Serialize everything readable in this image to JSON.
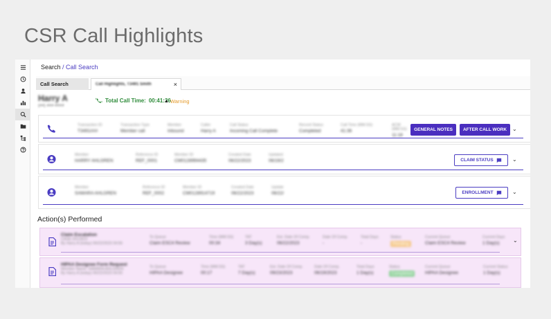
{
  "page": {
    "title": "CSR Call Highlights"
  },
  "sidebar": {
    "items": [
      {
        "icon": "menu-icon"
      },
      {
        "icon": "history-icon"
      },
      {
        "icon": "person-icon"
      },
      {
        "icon": "bar-chart-icon"
      },
      {
        "icon": "search-icon",
        "active": true
      },
      {
        "icon": "folder-icon"
      },
      {
        "icon": "hierarchy-icon"
      },
      {
        "icon": "help-icon"
      }
    ]
  },
  "breadcrumb": {
    "root": "Search",
    "separator": " / ",
    "current": "Call Search"
  },
  "tabs": [
    {
      "label": "Call Search"
    },
    {
      "label": "Call Highlights, T3491 Smith",
      "close": "×"
    }
  ],
  "member": {
    "name": "Harry A",
    "sub": "(##) ###-####"
  },
  "call": {
    "label": "Total Call Time:",
    "value": "00:41:36",
    "warning": "Warning"
  },
  "call_card": {
    "fields": [
      {
        "k": "Transaction ID",
        "v": "T3491###"
      },
      {
        "k": "Transaction Type",
        "v": "Member call"
      },
      {
        "k": "Member",
        "v": "Inbound"
      },
      {
        "k": "Caller",
        "v": "Harry A"
      },
      {
        "k": "Call Status",
        "v": "Incoming Call Complete"
      },
      {
        "k": "Record Status",
        "v": "Completed"
      },
      {
        "k": "Call Time (MM:SS)",
        "v": "41:36"
      },
      {
        "k": "ACW (MM:SS)",
        "v": "11:18"
      }
    ],
    "buttons": [
      "GENERAL NOTES",
      "AFTER CALL WORK"
    ]
  },
  "claim_card": {
    "fields": [
      {
        "k": "Member",
        "v": "HARRY AHLGREN"
      },
      {
        "k": "Reference ID",
        "v": "REF_0001"
      },
      {
        "k": "Member ID",
        "v": "CM0128994435"
      },
      {
        "k": "Created Date",
        "v": "06/22/2023"
      },
      {
        "k": "Updated",
        "v": "06/19/2"
      }
    ],
    "button": "CLAIM STATUS"
  },
  "enroll_card": {
    "fields": [
      {
        "k": "Member",
        "v": "SAMARA AHLGREN"
      },
      {
        "k": "Reference ID",
        "v": "REF_0002"
      },
      {
        "k": "Member ID",
        "v": "CM0128914719"
      },
      {
        "k": "Created Date",
        "v": "06/22/2023"
      },
      {
        "k": "Update",
        "v": "06/22/"
      }
    ],
    "button": "ENROLLMENT"
  },
  "actions": {
    "title": "Action(s) Performed",
    "items": [
      {
        "title": "Claim Escalation",
        "sub1": "CASE-0012823",
        "sub2": "By Harry A (today) 06/22/2023 04:56",
        "fields": [
          {
            "k": "To Queue",
            "v": "Claim ESC4 Review"
          },
          {
            "k": "Time (MM:SS)",
            "v": "00:34"
          },
          {
            "k": "TAT",
            "v": "3 Day(s)"
          },
          {
            "k": "Est. Date Of Comp.",
            "v": "06/22/2023"
          },
          {
            "k": "Date Of Comp.",
            "v": "-"
          },
          {
            "k": "Total Days",
            "v": "-"
          },
          {
            "k": "Status",
            "v": "Pending",
            "color": "#f0a650"
          },
          {
            "k": "Current Queue",
            "v": "Claim ESC4 Review"
          },
          {
            "k": "Current Days",
            "v": "1 Day(s)"
          }
        ]
      },
      {
        "title": "HIPAA Designee Form Request",
        "sub1": "Member Name: SAMARA AHLGREN",
        "sub2": "By Harry A (today) 06/22/2023 04:50",
        "fields": [
          {
            "k": "To Queue",
            "v": "HIPAA Designee"
          },
          {
            "k": "Time (MM:SS)",
            "v": "00:17"
          },
          {
            "k": "TAT",
            "v": "7 Day(s)"
          },
          {
            "k": "Est. Date Of Comp.",
            "v": "09/23/2023"
          },
          {
            "k": "Date Of Comp.",
            "v": "06/19/2023"
          },
          {
            "k": "Total Days",
            "v": "1 Day(s)"
          },
          {
            "k": "Status",
            "v": "Completed",
            "color": "#5bb56a"
          },
          {
            "k": "Current Queue",
            "v": "HIPAA Designee"
          },
          {
            "k": "Current Status",
            "v": "1 Day(s)"
          }
        ]
      }
    ]
  },
  "colors": {
    "accent": "#4a2ebf",
    "link": "#4a3cc2",
    "success": "#2e8b3a",
    "warning": "#e59a2a",
    "action_bg": "#f7e6f9"
  }
}
